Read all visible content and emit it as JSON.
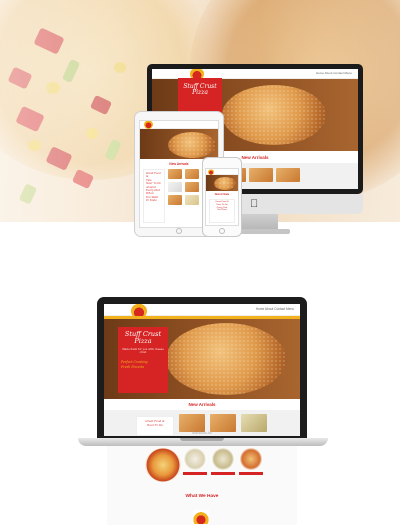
{
  "site": {
    "tagline": "Stuff Crust Pizza",
    "tagline_sub": "Made fresh for you with cheese crust",
    "features": [
      "Perfect Crusting",
      "Fresh Pizzeria"
    ],
    "new_arrivals": "New Arrivals",
    "what_we_have": "What We Have",
    "nav_links": "Home  About  Contact  Menu",
    "menu_card_text": [
      "Great Food &",
      "Tips",
      "Near To Do",
      "Around",
      "Every Diet",
      "When",
      "You Want",
      "To Taste"
    ]
  },
  "laptop": {
    "brand": "MacBook Air"
  },
  "colors": {
    "accent": "#d62424",
    "gold": "#f1b21d",
    "device_dark": "#1c1c1c"
  },
  "icons": [
    "apple-logo-icon",
    "pizza-logo-icon",
    "home-button-icon"
  ]
}
